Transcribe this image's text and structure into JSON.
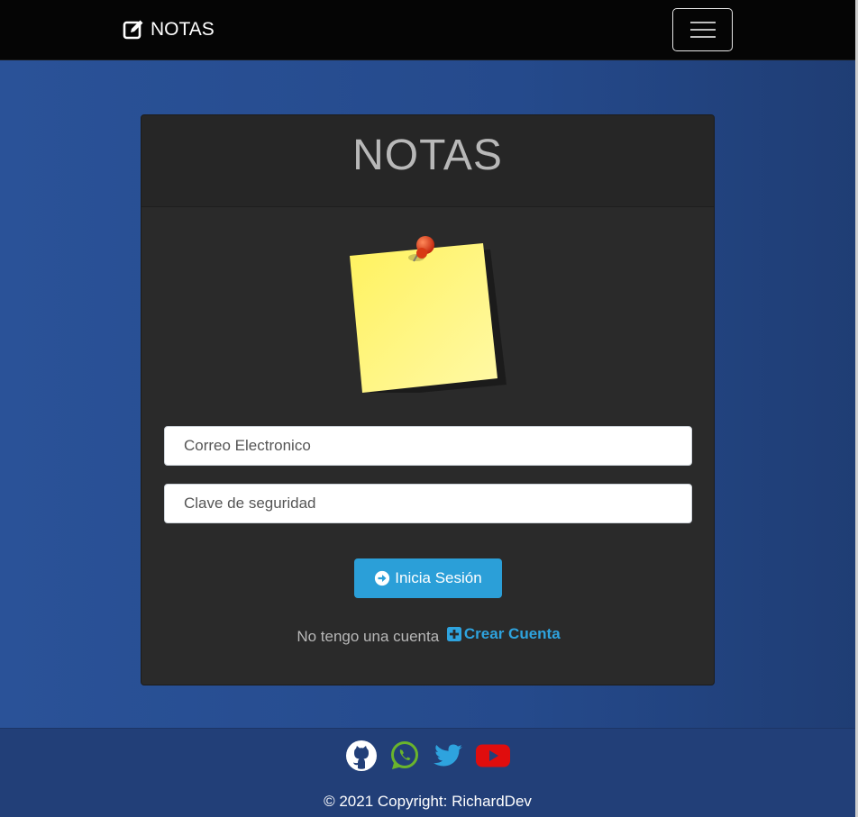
{
  "navbar": {
    "brand_label": "NOTAS",
    "brand_icon": "edit-icon",
    "menu_icon": "hamburger-icon"
  },
  "card": {
    "title": "NOTAS",
    "image": "sticky-note-with-pin",
    "email": {
      "placeholder": "Correo Electronico",
      "value": ""
    },
    "password": {
      "placeholder": "Clave de seguridad",
      "value": ""
    },
    "login_button": {
      "label": "Inicia Sesión",
      "icon": "arrow-circle-right-icon"
    },
    "register": {
      "prompt": "No tengo una cuenta",
      "link_label": "Crear Cuenta",
      "link_icon": "plus-square-icon"
    }
  },
  "footer": {
    "social": [
      {
        "name": "github",
        "icon": "github-icon"
      },
      {
        "name": "whatsapp",
        "icon": "whatsapp-icon"
      },
      {
        "name": "twitter",
        "icon": "twitter-icon"
      },
      {
        "name": "youtube",
        "icon": "youtube-icon"
      }
    ],
    "copyright": "© 2021 Copyright: RichardDev"
  },
  "colors": {
    "primary": "#2b9fd8",
    "navbar_bg": "#050505",
    "card_bg": "#2a2a2a",
    "page_bg": "#2a5298",
    "whatsapp": "#6ab42c",
    "twitter": "#2ea3de",
    "youtube": "#e00d0d"
  }
}
